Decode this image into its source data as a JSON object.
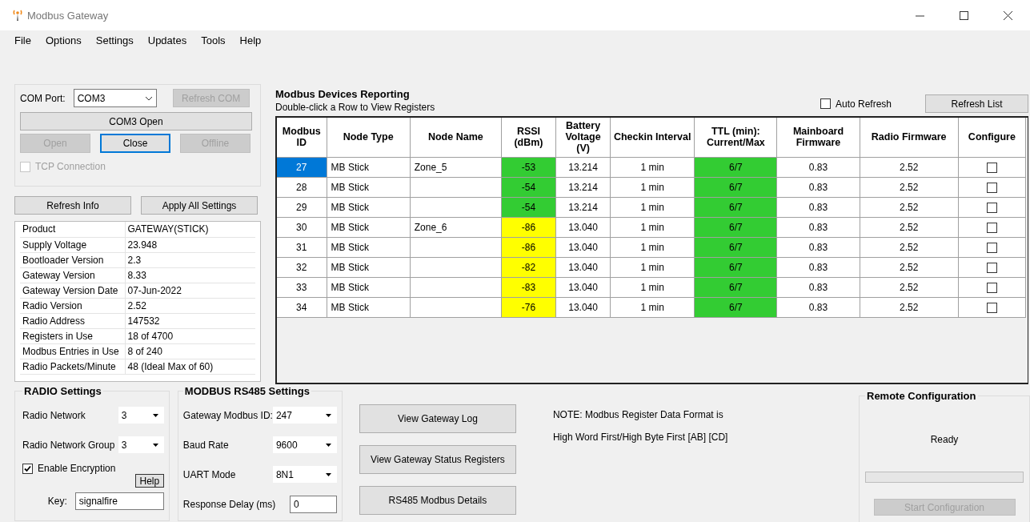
{
  "window": {
    "title": "Modbus Gateway"
  },
  "menu": [
    "File",
    "Options",
    "Settings",
    "Updates",
    "Tools",
    "Help"
  ],
  "com_panel": {
    "port_label": "COM Port:",
    "port_value": "COM3",
    "refresh_button": {
      "label": "Refresh COM",
      "disabled": true
    },
    "status_button": "COM3 Open",
    "buttons": [
      {
        "label": "Open",
        "disabled": true,
        "focused": false
      },
      {
        "label": "Close",
        "disabled": false,
        "focused": true
      },
      {
        "label": "Offline",
        "disabled": true,
        "focused": false
      }
    ],
    "tcp": {
      "label": "TCP Connection",
      "checked": false,
      "disabled": true
    }
  },
  "info_buttons": [
    "Refresh Info",
    "Apply All Settings"
  ],
  "info": [
    {
      "label": "Product",
      "value": "GATEWAY(STICK)"
    },
    {
      "label": "Supply Voltage",
      "value": "23.948"
    },
    {
      "label": "Bootloader Version",
      "value": "2.3"
    },
    {
      "label": "Gateway Version",
      "value": "8.33"
    },
    {
      "label": "Gateway Version Date",
      "value": "07-Jun-2022"
    },
    {
      "label": "Radio Version",
      "value": "2.52"
    },
    {
      "label": "Radio Address",
      "value": "147532"
    },
    {
      "label": "Registers in Use",
      "value": "18 of 4700"
    },
    {
      "label": "Modbus Entries in Use",
      "value": "8 of 240"
    },
    {
      "label": "Radio Packets/Minute",
      "value": "48 (Ideal Max of 60)"
    }
  ],
  "devices": {
    "title": "Modbus Devices Reporting",
    "hint": "Double-click a Row to View Registers",
    "auto_refresh": {
      "label": "Auto Refresh",
      "checked": false
    },
    "refresh_button": "Refresh List",
    "columns": [
      "Modbus ID",
      "Node Type",
      "Node Name",
      "RSSI (dBm)",
      "Battery Voltage (V)",
      "Checkin Interval",
      "TTL (min): Current/Max",
      "Mainboard Firmware",
      "Radio Firmware",
      "Configure"
    ],
    "rows": [
      {
        "selected": true,
        "modbus_id": "27",
        "node_type": "MB Stick",
        "node_name": "Zone_5",
        "rssi": {
          "text": "-53",
          "color": "#33cc33"
        },
        "battery": "13.214",
        "checkin": "1 min",
        "ttl": {
          "text": "6/7",
          "color": "#33cc33"
        },
        "mainboard_fw": "0.83",
        "radio_fw": "2.52",
        "configure": false
      },
      {
        "selected": false,
        "modbus_id": "28",
        "node_type": "MB Stick",
        "node_name": "",
        "rssi": {
          "text": "-54",
          "color": "#33cc33"
        },
        "battery": "13.214",
        "checkin": "1 min",
        "ttl": {
          "text": "6/7",
          "color": "#33cc33"
        },
        "mainboard_fw": "0.83",
        "radio_fw": "2.52",
        "configure": false
      },
      {
        "selected": false,
        "modbus_id": "29",
        "node_type": "MB Stick",
        "node_name": "",
        "rssi": {
          "text": "-54",
          "color": "#33cc33"
        },
        "battery": "13.214",
        "checkin": "1 min",
        "ttl": {
          "text": "6/7",
          "color": "#33cc33"
        },
        "mainboard_fw": "0.83",
        "radio_fw": "2.52",
        "configure": false
      },
      {
        "selected": false,
        "modbus_id": "30",
        "node_type": "MB Stick",
        "node_name": "Zone_6",
        "rssi": {
          "text": "-86",
          "color": "#ffff00"
        },
        "battery": "13.040",
        "checkin": "1 min",
        "ttl": {
          "text": "6/7",
          "color": "#33cc33"
        },
        "mainboard_fw": "0.83",
        "radio_fw": "2.52",
        "configure": false
      },
      {
        "selected": false,
        "modbus_id": "31",
        "node_type": "MB Stick",
        "node_name": "",
        "rssi": {
          "text": "-86",
          "color": "#ffff00"
        },
        "battery": "13.040",
        "checkin": "1 min",
        "ttl": {
          "text": "6/7",
          "color": "#33cc33"
        },
        "mainboard_fw": "0.83",
        "radio_fw": "2.52",
        "configure": false
      },
      {
        "selected": false,
        "modbus_id": "32",
        "node_type": "MB Stick",
        "node_name": "",
        "rssi": {
          "text": "-82",
          "color": "#ffff00"
        },
        "battery": "13.040",
        "checkin": "1 min",
        "ttl": {
          "text": "6/7",
          "color": "#33cc33"
        },
        "mainboard_fw": "0.83",
        "radio_fw": "2.52",
        "configure": false
      },
      {
        "selected": false,
        "modbus_id": "33",
        "node_type": "MB Stick",
        "node_name": "",
        "rssi": {
          "text": "-83",
          "color": "#ffff00"
        },
        "battery": "13.040",
        "checkin": "1 min",
        "ttl": {
          "text": "6/7",
          "color": "#33cc33"
        },
        "mainboard_fw": "0.83",
        "radio_fw": "2.52",
        "configure": false
      },
      {
        "selected": false,
        "modbus_id": "34",
        "node_type": "MB Stick",
        "node_name": "",
        "rssi": {
          "text": "-76",
          "color": "#ffff00"
        },
        "battery": "13.040",
        "checkin": "1 min",
        "ttl": {
          "text": "6/7",
          "color": "#33cc33"
        },
        "mainboard_fw": "0.83",
        "radio_fw": "2.52",
        "configure": false
      }
    ]
  },
  "radio_settings": {
    "title": "RADIO Settings",
    "fields": [
      {
        "label": "Radio Network",
        "value": "3"
      },
      {
        "label": "Radio Network Group",
        "value": "3"
      }
    ],
    "encryption": {
      "label": "Enable Encryption",
      "checked": true
    },
    "help_button": "Help",
    "key": {
      "label": "Key:",
      "value": "signalfire"
    }
  },
  "modbus_settings": {
    "title": "MODBUS RS485 Settings",
    "fields": [
      {
        "kind": "dropdown",
        "label": "Gateway Modbus ID:",
        "value": "247"
      },
      {
        "kind": "dropdown",
        "label": "Baud Rate",
        "value": "9600"
      },
      {
        "kind": "dropdown",
        "label": "UART Mode",
        "value": "8N1"
      },
      {
        "kind": "input",
        "label": "Response Delay (ms)",
        "value": "0"
      }
    ]
  },
  "actions": [
    "View Gateway Log",
    "View Gateway Status Registers",
    "RS485 Modbus Details"
  ],
  "note": [
    "NOTE: Modbus Register Data Format is",
    "High Word First/High Byte First [AB] [CD]"
  ],
  "remote_config": {
    "title": "Remote Configuration",
    "status": "Ready",
    "level": 0,
    "button": {
      "label": "Start Configuration",
      "disabled": true
    }
  }
}
